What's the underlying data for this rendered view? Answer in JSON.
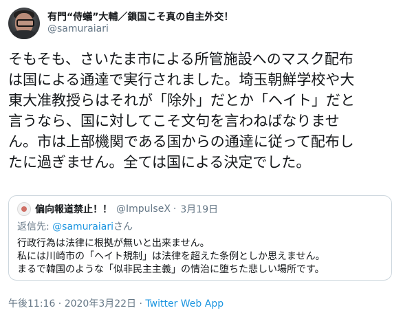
{
  "author": {
    "display_name": "有門“侍蟻”大輔／鎖国こそ真の自主外交！",
    "handle": "@samuraiari"
  },
  "tweet": {
    "lines": [
      "そもそも、さいたま市による所管施設へのマスク配布",
      "は国による通達で実行されました。埼玉朝鮮学校や大",
      "東大准教授らはそれが「除外」だとか「ヘイト」だと",
      "言うなら、国に対してこそ文句を言わねばなりませ",
      "ん。市は上部機関である国からの通達に従って配布し",
      "たに過ぎません。全ては国による決定でした。"
    ]
  },
  "quoted": {
    "display_name": "偏向報道禁止！！",
    "handle": "@ImpulseX",
    "separator": "·",
    "date": "3月19日",
    "reply_prefix": "返信先: ",
    "reply_mention": "@samuraiari",
    "reply_suffix": "さん",
    "lines": [
      "行政行為は法律に根拠が無いと出来ません。",
      "私には川崎市の「ヘイト規制」は法律を超えた条例としか思えません。",
      "まるで韓国のような「似非民主主義」の情治に堕ちた悲しい場所です。"
    ]
  },
  "meta": {
    "time": "午後11:16 · 2020年3月22日 · ",
    "app": "Twitter Web App"
  }
}
